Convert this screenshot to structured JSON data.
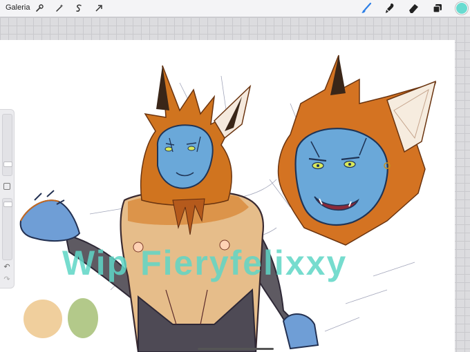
{
  "toolbar": {
    "gallery_label": "Galeria",
    "left_tools": [
      "wrench-icon",
      "magic-wand-icon",
      "selection-icon",
      "transform-arrow-icon"
    ],
    "right_tools": [
      "brush-icon",
      "smudge-icon",
      "eraser-icon",
      "layers-icon"
    ],
    "active_color": "#69dbd0"
  },
  "canvas": {
    "watermark_text": "Wip Fieryfelixxy",
    "palette_swatches": [
      "#f0cf9d",
      "#b3c98a"
    ]
  },
  "sidebar": {
    "brush_size_level": 0.2,
    "opacity_level": 0.05
  }
}
